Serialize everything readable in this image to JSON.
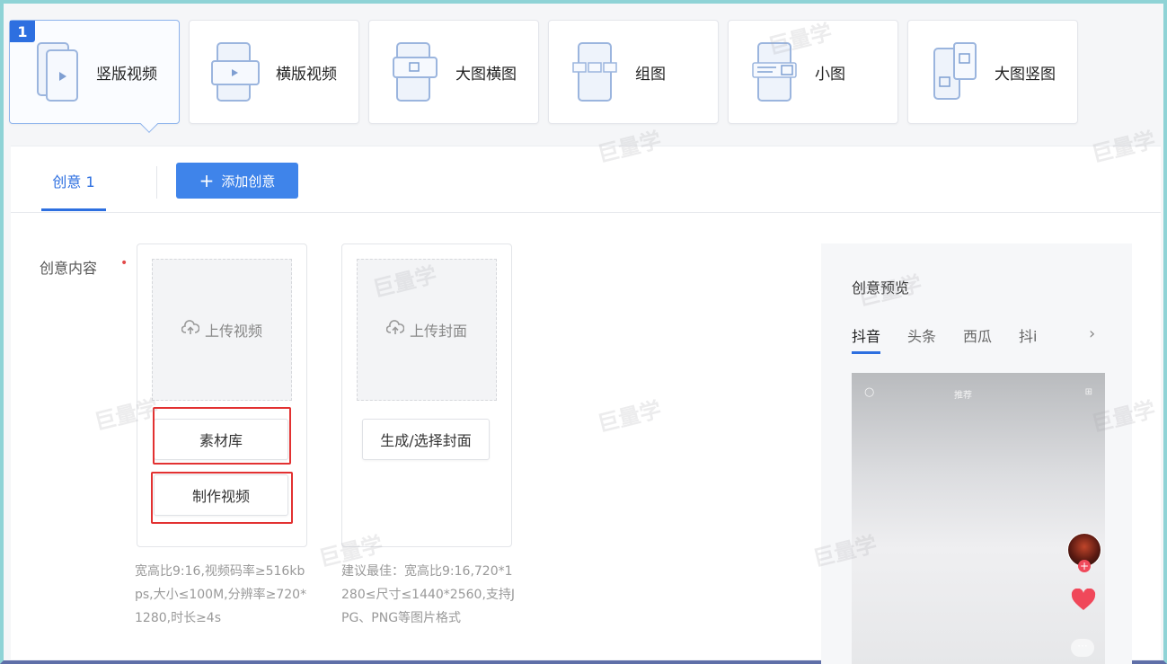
{
  "formats": [
    {
      "num": "1",
      "label": "竖版视频",
      "icon": "vertical-video-icon",
      "active": true
    },
    {
      "label": "横版视频",
      "icon": "horizontal-video-icon"
    },
    {
      "label": "大图横图",
      "icon": "large-horizontal-image-icon"
    },
    {
      "label": "组图",
      "icon": "image-group-icon"
    },
    {
      "label": "小图",
      "icon": "small-image-icon"
    },
    {
      "label": "大图竖图",
      "icon": "large-vertical-image-icon"
    }
  ],
  "tabs": {
    "creative_tab": "创意 1",
    "add_button": "添加创意"
  },
  "form": {
    "content_label": "创意内容",
    "required_mark": "•"
  },
  "video_card": {
    "upload_label": "上传视频",
    "library_button": "素材库",
    "make_video_button": "制作视频",
    "hint": "宽高比9:16,视频码率≥516kbps,大小≤100M,分辨率≥720*1280,时长≥4s"
  },
  "cover_card": {
    "upload_label": "上传封面",
    "generate_button": "生成/选择封面",
    "hint": "建议最佳：宽高比9:16,720*1280≤尺寸≤1440*2560,支持JPG、PNG等图片格式"
  },
  "preview": {
    "title": "创意预览",
    "tabs": [
      "抖音",
      "头条",
      "西瓜",
      "抖i"
    ],
    "phone_top": "推荐"
  },
  "watermark": "巨量学",
  "colors": {
    "accent": "#2d6fe0",
    "button": "#3f84ea",
    "highlight": "#e23131"
  }
}
